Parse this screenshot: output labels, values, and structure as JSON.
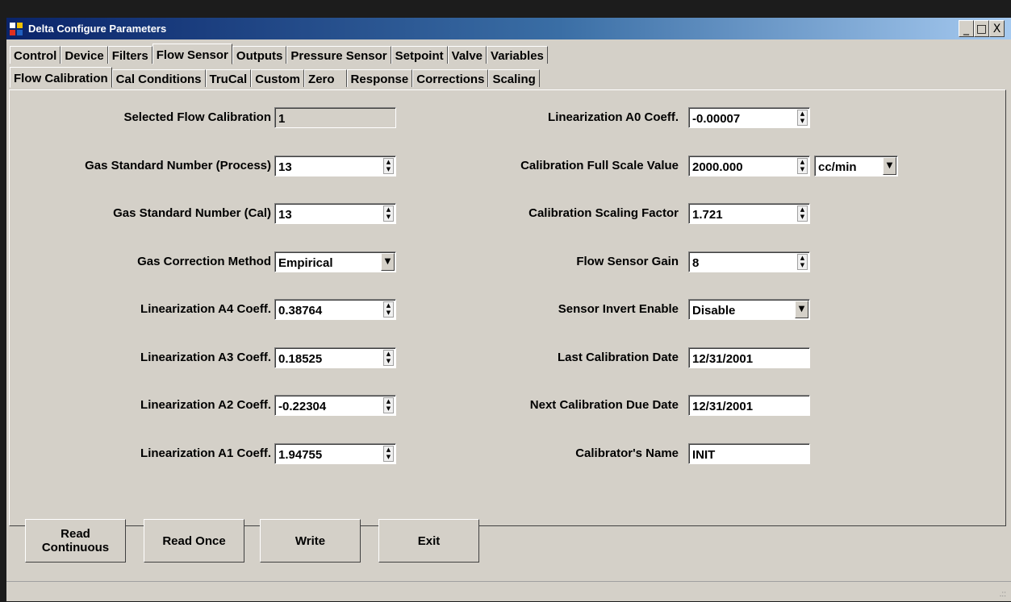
{
  "window": {
    "title": "Delta Configure Parameters",
    "minimize": "_",
    "maximize": "□",
    "close": "X"
  },
  "tabs_main": [
    "Control",
    "Device",
    "Filters",
    "Flow Sensor",
    "Outputs",
    "Pressure Sensor",
    "Setpoint",
    "Valve",
    "Variables"
  ],
  "tabs_main_active": "Flow Sensor",
  "tabs_sub": [
    "Flow Calibration",
    "Cal Conditions",
    "TruCal",
    "Custom",
    "Zero",
    "Response",
    "Corrections",
    "Scaling"
  ],
  "tabs_sub_active": "Flow Calibration",
  "left": {
    "selected_flow_cal": {
      "label": "Selected Flow Calibration",
      "value": "1"
    },
    "gas_std_process": {
      "label": "Gas Standard Number (Process)",
      "value": "13"
    },
    "gas_std_cal": {
      "label": "Gas Standard Number (Cal)",
      "value": "13"
    },
    "gas_corr_method": {
      "label": "Gas Correction Method",
      "value": "Empirical"
    },
    "lin_a4": {
      "label": "Linearization A4 Coeff.",
      "value": "0.38764"
    },
    "lin_a3": {
      "label": "Linearization A3 Coeff.",
      "value": "0.18525"
    },
    "lin_a2": {
      "label": "Linearization A2 Coeff.",
      "value": "-0.22304"
    },
    "lin_a1": {
      "label": "Linearization A1 Coeff.",
      "value": "1.94755"
    }
  },
  "right": {
    "lin_a0": {
      "label": "Linearization A0 Coeff.",
      "value": "-0.00007"
    },
    "cal_full_scale": {
      "label": "Calibration Full Scale Value",
      "value": "2000.000",
      "unit": "cc/min"
    },
    "cal_scaling": {
      "label": "Calibration Scaling Factor",
      "value": "1.721"
    },
    "flow_sensor_gain": {
      "label": "Flow Sensor Gain",
      "value": "8"
    },
    "sensor_invert": {
      "label": "Sensor Invert Enable",
      "value": "Disable"
    },
    "last_cal_date": {
      "label": "Last Calibration Date",
      "value": "12/31/2001"
    },
    "next_cal_date": {
      "label": "Next Calibration Due Date",
      "value": "12/31/2001"
    },
    "calibrator_name": {
      "label": "Calibrator's Name",
      "value": "INIT"
    }
  },
  "buttons": {
    "read_continuous_1": "Read",
    "read_continuous_2": "Continuous",
    "read_once": "Read Once",
    "write": "Write",
    "exit": "Exit"
  },
  "icons": {
    "spin": "spinner-icon",
    "dropdown": "chevron-down-icon",
    "grip": "resize-grip-icon"
  }
}
